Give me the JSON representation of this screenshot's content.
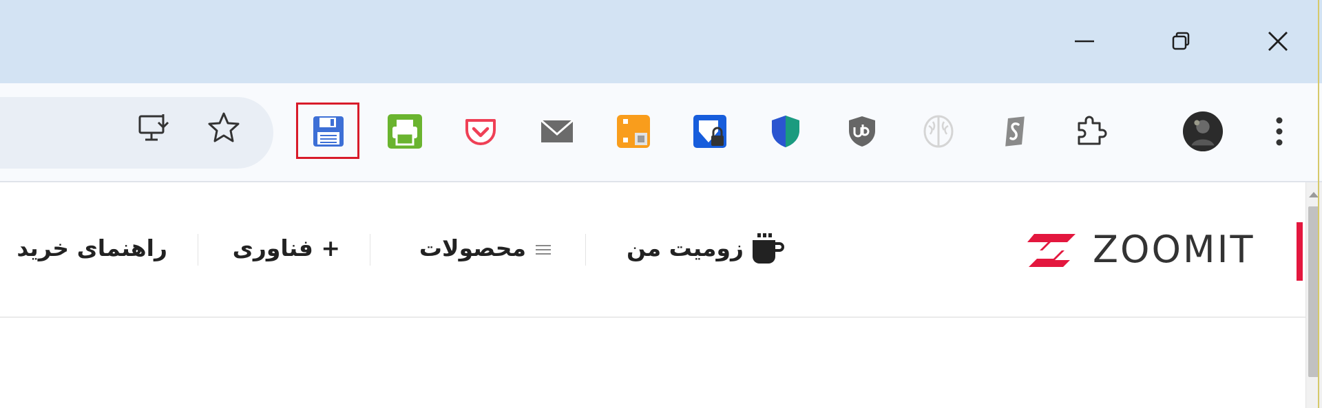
{
  "window_controls": {
    "minimize_icon": "minimize-icon",
    "restore_icon": "restore-icon",
    "close_icon": "close-icon"
  },
  "toolbar": {
    "omnibox_icons": [
      "install-app-icon",
      "bookmark-star-icon"
    ],
    "extensions": [
      {
        "name": "save-page-extension",
        "highlighted": true,
        "color": "#3d6fd6"
      },
      {
        "name": "print-friendly-extension",
        "color": "#6ab42f"
      },
      {
        "name": "pocket-extension",
        "color": "#ef4056"
      },
      {
        "name": "mail-extension",
        "color": "#6b6b6b"
      },
      {
        "name": "orange-extension",
        "color": "#f99d1c"
      },
      {
        "name": "bitwarden-lock-extension",
        "color": "#175ddc"
      },
      {
        "name": "shield-extension",
        "color": "#1a73e8"
      },
      {
        "name": "ublock-origin-extension",
        "color": "#666666"
      },
      {
        "name": "brain-extension",
        "color": "#d0d0d0"
      },
      {
        "name": "surfshark-extension",
        "color": "#8a8a8a"
      },
      {
        "name": "extensions-puzzle",
        "color": "#444444"
      }
    ],
    "profile_icon": "profile-avatar",
    "menu_icon": "kebab-menu-icon"
  },
  "site": {
    "logo_text": "ZOOMIT",
    "brand_color": "#e3173e",
    "nav": {
      "my_zoomit": "زومیت من",
      "products": "محصولات",
      "technology": "+ فناوری",
      "buying_guide": "راهنمای خرید"
    }
  }
}
